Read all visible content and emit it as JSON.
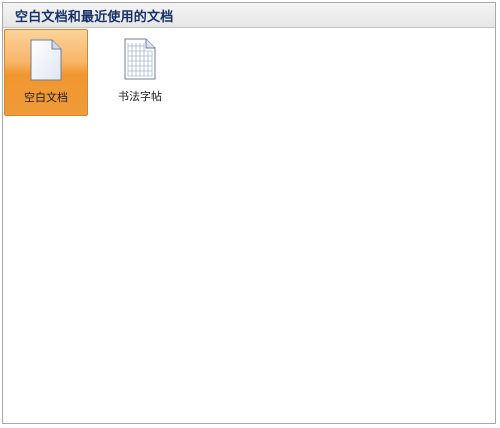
{
  "header": {
    "title": "空白文档和最近使用的文档"
  },
  "items": [
    {
      "label": "空白文档",
      "icon": "blank-document-icon",
      "selected": true
    },
    {
      "label": "书法字帖",
      "icon": "calligraphy-grid-document-icon",
      "selected": false
    }
  ],
  "colors": {
    "selected_top": "#fbd39a",
    "selected_mid": "#f0962f",
    "selected_border": "#d7862d",
    "title_text": "#15306b"
  }
}
